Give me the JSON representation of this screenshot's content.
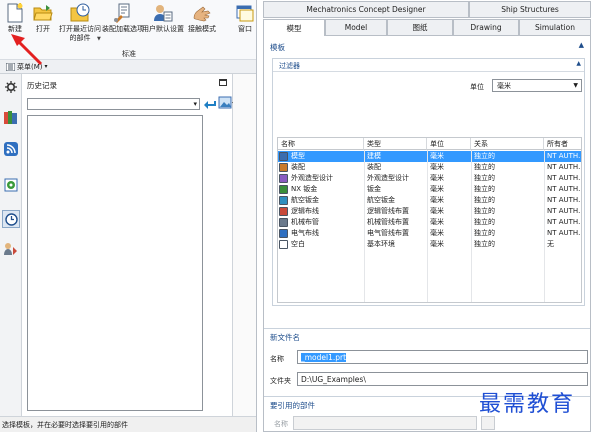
{
  "ribbon": {
    "buttons": [
      {
        "label": "新建",
        "icon": "new-file-icon"
      },
      {
        "label": "打开",
        "icon": "open-folder-icon"
      },
      {
        "label": "打开最近访问的部件",
        "icon": "recent-parts-icon"
      },
      {
        "label": "装配加载选项",
        "icon": "assembly-load-icon"
      },
      {
        "label": "用户默认设置",
        "icon": "user-defaults-icon"
      },
      {
        "label": "接触模式",
        "icon": "touch-mode-icon"
      },
      {
        "label": "窗口",
        "icon": "window-icon"
      }
    ],
    "group_label": "标准"
  },
  "toolbar2": {
    "menu_label": "菜单(M)",
    "menu_caret": "▾"
  },
  "history": {
    "title": "历史记录"
  },
  "status": {
    "text": "选择模板，并在必要时选择要引用的部件"
  },
  "tabs": {
    "top_row": [
      "Mechatronics Concept Designer",
      "Ship Structures"
    ],
    "bottom_row": [
      "模型",
      "Model",
      "图纸",
      "Drawing",
      "Simulation"
    ],
    "active": "模型"
  },
  "templates": {
    "section_title": "模板",
    "filter_title": "过滤器",
    "unit_label": "单位",
    "unit_value": "毫米",
    "columns": [
      "名称",
      "类型",
      "单位",
      "关系",
      "所有者"
    ],
    "rows": [
      {
        "name": "模型",
        "type": "建模",
        "unit": "毫米",
        "relation": "独立的",
        "owner": "NT AUTH...",
        "icon": "model-icon",
        "selected": true
      },
      {
        "name": "装配",
        "type": "装配",
        "unit": "毫米",
        "relation": "独立的",
        "owner": "NT AUTH...",
        "icon": "assembly-icon",
        "selected": false
      },
      {
        "name": "外观造型设计",
        "type": "外观造型设计",
        "unit": "毫米",
        "relation": "独立的",
        "owner": "NT AUTH...",
        "icon": "shape-studio-icon",
        "selected": false
      },
      {
        "name": "NX 钣金",
        "type": "钣金",
        "unit": "毫米",
        "relation": "独立的",
        "owner": "NT AUTH...",
        "icon": "sheet-metal-icon",
        "selected": false
      },
      {
        "name": "航空钣金",
        "type": "航空钣金",
        "unit": "毫米",
        "relation": "独立的",
        "owner": "NT AUTH...",
        "icon": "aero-sheet-metal-icon",
        "selected": false
      },
      {
        "name": "逻辑布线",
        "type": "逻辑管线布置",
        "unit": "毫米",
        "relation": "独立的",
        "owner": "NT AUTH...",
        "icon": "logical-routing-icon",
        "selected": false
      },
      {
        "name": "机械布管",
        "type": "机械管线布置",
        "unit": "毫米",
        "relation": "独立的",
        "owner": "NT AUTH...",
        "icon": "mechanical-routing-icon",
        "selected": false
      },
      {
        "name": "电气布线",
        "type": "电气管线布置",
        "unit": "毫米",
        "relation": "独立的",
        "owner": "NT AUTH...",
        "icon": "electrical-routing-icon",
        "selected": false
      },
      {
        "name": "空白",
        "type": "基本环境",
        "unit": "毫米",
        "relation": "独立的",
        "owner": "无",
        "icon": "blank-icon",
        "selected": false
      }
    ]
  },
  "new_file": {
    "section_title": "新文件名",
    "name_label": "名称",
    "name_value": "_model1.prt",
    "folder_label": "文件夹",
    "folder_value": "D:\\UG_Examples\\"
  },
  "ref_part": {
    "section_title": "要引用的部件",
    "name_label": "名称",
    "name_value": ""
  },
  "watermark": "最需教育"
}
